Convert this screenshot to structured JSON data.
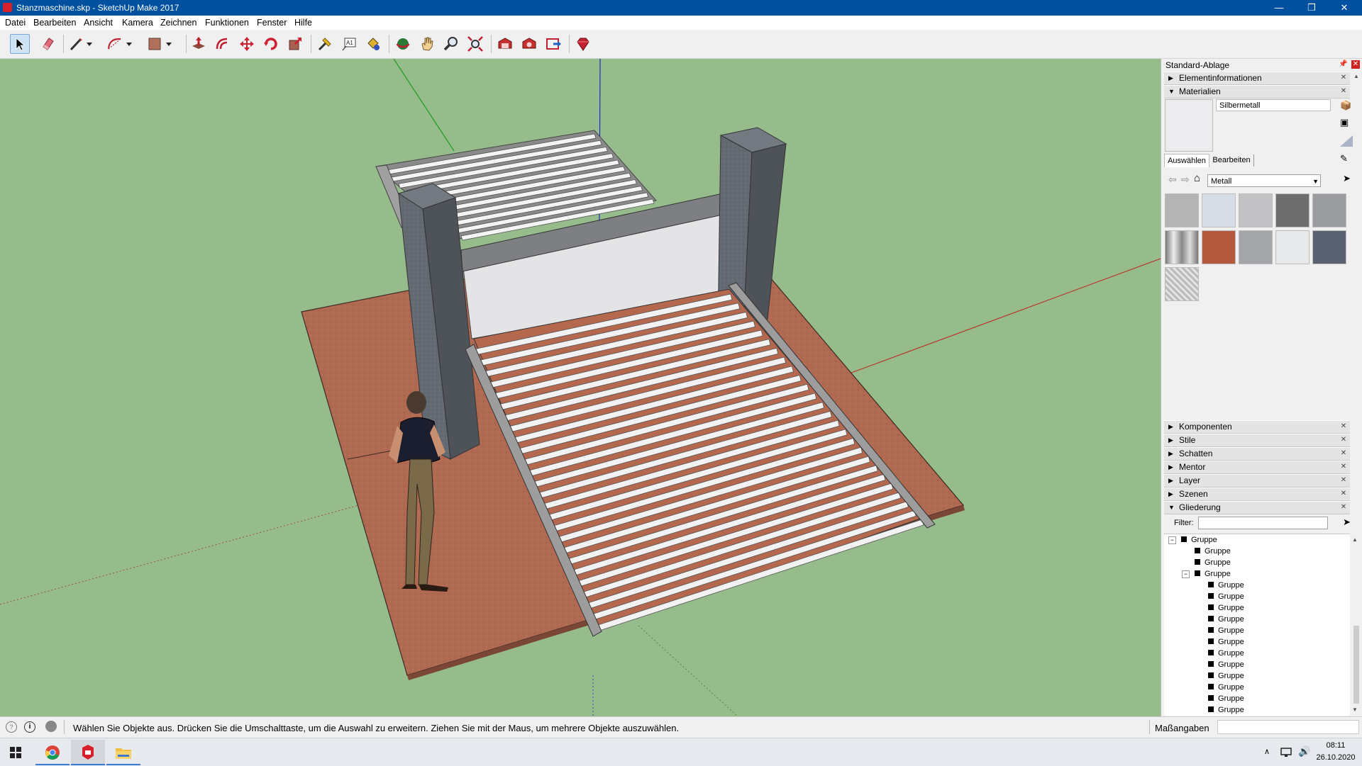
{
  "window": {
    "title": "Stanzmaschine.skp - SketchUp Make 2017"
  },
  "menu": {
    "items": [
      "Datei",
      "Bearbeiten",
      "Ansicht",
      "Kamera",
      "Zeichnen",
      "Funktionen",
      "Fenster",
      "Hilfe"
    ]
  },
  "toolbar": {
    "tools": [
      "select-tool",
      "eraser-tool",
      "line-tool",
      "arc-tool",
      "rectangle-tool",
      "push-pull-tool",
      "offset-tool",
      "move-tool",
      "rotate-tool",
      "scale-tool",
      "tape-measure-tool",
      "text-tool",
      "paint-bucket-tool",
      "orbit-tool",
      "pan-tool",
      "zoom-tool",
      "zoom-extents-tool",
      "warehouse-tool",
      "extension-tool",
      "share-model-tool",
      "ruby-tool"
    ]
  },
  "tray": {
    "title": "Standard-Ablage",
    "panels": {
      "entity_info": "Elementinformationen",
      "materials": "Materialien",
      "components": "Komponenten",
      "styles": "Stile",
      "shadows": "Schatten",
      "mentor": "Mentor",
      "layers": "Layer",
      "scenes": "Szenen",
      "outliner": "Gliederung"
    },
    "materials": {
      "current_name": "Silbermetall",
      "tab_select": "Auswählen",
      "tab_edit": "Bearbeiten",
      "library": "Metall",
      "swatches": [
        "#b4b4b4",
        "#d6dde6",
        "#c2c2c4",
        "#6e6e6e",
        "#9a9ca0",
        "#9e9e9e",
        "#b4583e",
        "#a3a5a8",
        "#e8e9ea",
        "#5a6272",
        "#c8c8c8"
      ]
    },
    "outliner": {
      "filter_label": "Filter:",
      "filter_value": "",
      "rows": [
        "Gruppe",
        "Gruppe",
        "Gruppe",
        "Gruppe",
        "Gruppe",
        "Gruppe",
        "Gruppe",
        "Gruppe",
        "Gruppe",
        "Gruppe",
        "Gruppe",
        "Gruppe",
        "Gruppe",
        "Gruppe",
        "Gruppe",
        "Gruppe"
      ]
    }
  },
  "status": {
    "message": "Wählen Sie Objekte aus. Drücken Sie die Umschalttaste, um die Auswahl zu erweitern. Ziehen Sie mit der Maus, um mehrere Objekte auszuwählen.",
    "measure_label": "Maßangaben",
    "measure_value": ""
  },
  "taskbar": {
    "time": "08:11",
    "date": "26.10.2020"
  },
  "colors": {
    "sky": "#97bc8c",
    "floor": "#b06a52",
    "pillar": "#5f646c",
    "rail": "#9a9a9a",
    "slat": "#f2f2f2",
    "titlebar": "#0050a0"
  }
}
